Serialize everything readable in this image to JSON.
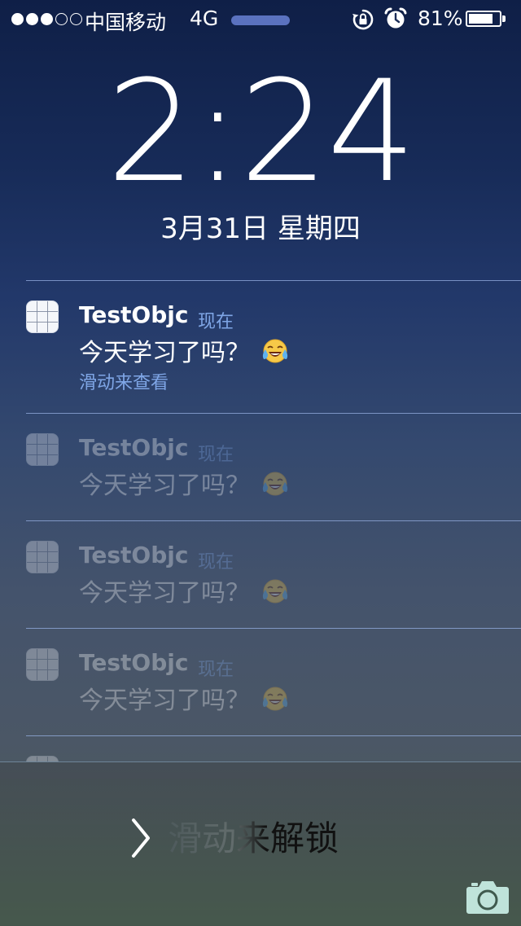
{
  "status_bar": {
    "signal_bars_filled": 3,
    "signal_bars_total": 5,
    "carrier": "中国移动",
    "network": "4G",
    "battery_percent_text": "81%",
    "battery_level": 0.81,
    "icons": [
      "rotation-lock-icon",
      "alarm-icon",
      "battery-icon"
    ]
  },
  "lock_screen": {
    "time": "2:24",
    "date": "3月31日 星期四"
  },
  "notifications": [
    {
      "app": "TestObjc",
      "time": "现在",
      "message": "今天学习了吗？",
      "emoji": "face-with-tears-of-joy",
      "action": "滑动来查看"
    },
    {
      "app": "TestObjc",
      "time": "现在",
      "message": "今天学习了吗？",
      "emoji": "face-with-tears-of-joy"
    },
    {
      "app": "TestObjc",
      "time": "现在",
      "message": "今天学习了吗？",
      "emoji": "face-with-tears-of-joy"
    },
    {
      "app": "TestObjc",
      "time": "现在",
      "message": "今天学习了吗？",
      "emoji": "face-with-tears-of-joy"
    }
  ],
  "unlock": {
    "label": "滑动来解锁",
    "icons": [
      "chevron-right-icon",
      "camera-icon"
    ]
  },
  "colors": {
    "accent_blue": "#7fa6e6",
    "load_bar": "#5b72bf",
    "camera_icon": "#bfe3da"
  }
}
